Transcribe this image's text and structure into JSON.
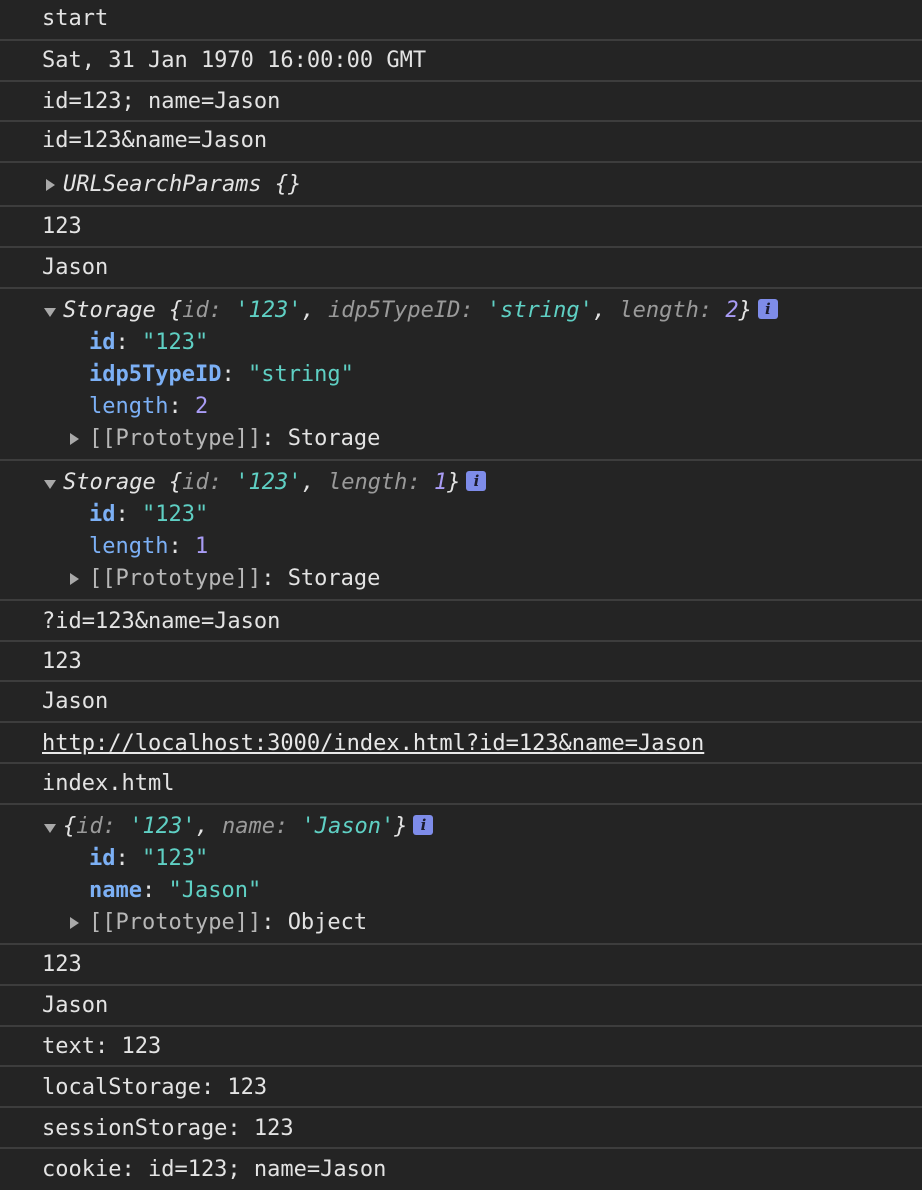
{
  "logs": {
    "start": "start",
    "date": "Sat, 31 Jan 1970 16:00:00 GMT",
    "cookie_str": "id=123; name=Jason",
    "query_str": "id=123&name=Jason",
    "urlsp": "URLSearchParams {}",
    "get_id": "123",
    "get_name": "Jason",
    "storage1": {
      "prefix": "Storage {",
      "k1": "id",
      "v1": "'123'",
      "k2": "idp5TypeID",
      "v2": "'string'",
      "k3": "length",
      "v3": "2",
      "suffix": "}",
      "p1_key": "id",
      "p1_val": "\"123\"",
      "p2_key": "idp5TypeID",
      "p2_val": "\"string\"",
      "p3_key": "length",
      "p3_val": "2",
      "proto_key": "[[Prototype]]",
      "proto_val": "Storage"
    },
    "storage2": {
      "prefix": "Storage {",
      "k1": "id",
      "v1": "'123'",
      "k2": "length",
      "v2": "1",
      "suffix": "}",
      "p1_key": "id",
      "p1_val": "\"123\"",
      "p2_key": "length",
      "p2_val": "1",
      "proto_key": "[[Prototype]]",
      "proto_val": "Storage"
    },
    "search": "?id=123&name=Jason",
    "search_id": "123",
    "search_name": "Jason",
    "href": "http://localhost:3000/index.html?id=123&name=Jason",
    "filename": "index.html",
    "object": {
      "prefix": "{",
      "k1": "id",
      "v1": "'123'",
      "k2": "name",
      "v2": "'Jason'",
      "suffix": "}",
      "p1_key": "id",
      "p1_val": "\"123\"",
      "p2_key": "name",
      "p2_val": "\"Jason\"",
      "proto_key": "[[Prototype]]",
      "proto_val": "Object"
    },
    "obj_id": "123",
    "obj_name": "Jason",
    "text": "text: 123",
    "local": "localStorage: 123",
    "session": "sessionStorage: 123",
    "cookie": "cookie: id=123; name=Jason"
  }
}
